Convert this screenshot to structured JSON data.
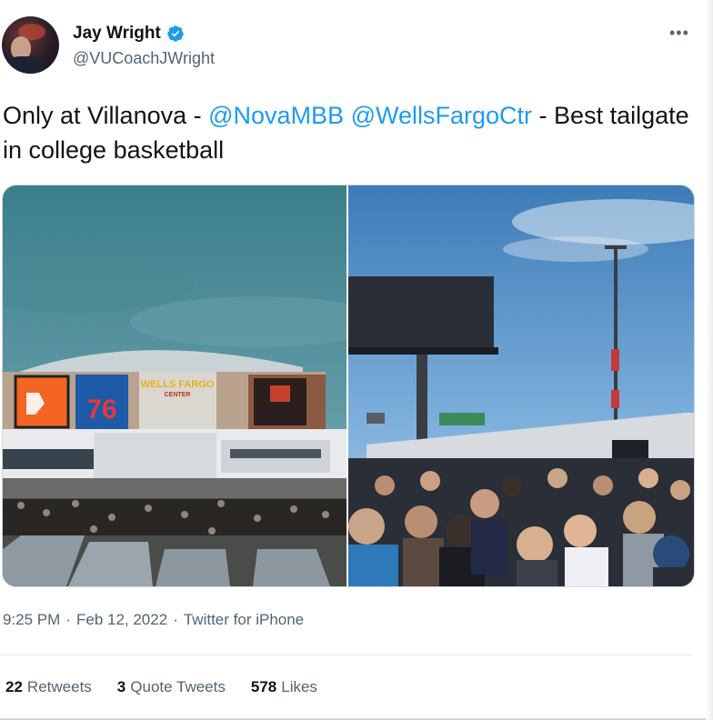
{
  "author": {
    "display_name": "Jay Wright",
    "handle": "@VUCoachJWright",
    "verified": true
  },
  "more_icon": "more-horizontal-icon",
  "tweet": {
    "text_before": "Only at Villanova - ",
    "mention_1": "@NovaMBB",
    "text_between": " ",
    "mention_2": "@WellsFargoCtr",
    "text_after": " - Best tailgate in college basketball"
  },
  "media": {
    "left_photo": {
      "sign_text": "WELLS FARGO",
      "sign_subtext": "CENTER",
      "banner_76": "76"
    }
  },
  "meta": {
    "time": "9:25 PM",
    "date": "Feb 12, 2022",
    "source": "Twitter for iPhone"
  },
  "stats": {
    "retweets_count": "22",
    "retweets_label": "Retweets",
    "quote_count": "3",
    "quote_label": "Quote Tweets",
    "likes_count": "578",
    "likes_label": "Likes"
  },
  "colors": {
    "link": "#1d9bf0",
    "secondary_text": "#536471",
    "primary_text": "#0f1419",
    "verified": "#1d9bf0"
  }
}
